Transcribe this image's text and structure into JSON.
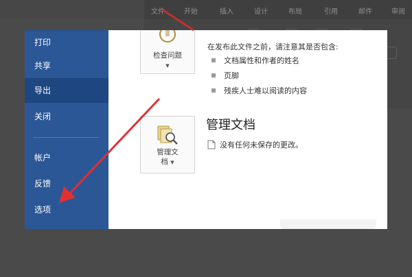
{
  "ribbon_tabs": [
    "文件",
    "开始",
    "插入",
    "设计",
    "布局",
    "引用",
    "邮件",
    "审阅"
  ],
  "sidebar": {
    "items": [
      {
        "label": "打印",
        "active": false
      },
      {
        "label": "共享",
        "active": false
      },
      {
        "label": "导出",
        "active": true
      },
      {
        "label": "关闭",
        "active": false
      },
      {
        "label": "帐户",
        "active": false
      },
      {
        "label": "反馈",
        "active": false
      },
      {
        "label": "选项",
        "active": false
      }
    ]
  },
  "inspect": {
    "button_label": "检查问题",
    "description": "在发布此文件之前，请注意其是否包含:",
    "items": [
      "文档属性和作者的姓名",
      "页脚",
      "残疾人士难以阅读的内容"
    ]
  },
  "manage": {
    "button_label_line1": "管理文",
    "button_label_line2": "档",
    "heading": "管理文档",
    "status": "没有任何未保存的更改。"
  },
  "colors": {
    "sidebar": "#2b5797",
    "sidebar_active": "#1e4680",
    "annotation_arrow": "#e03030"
  }
}
